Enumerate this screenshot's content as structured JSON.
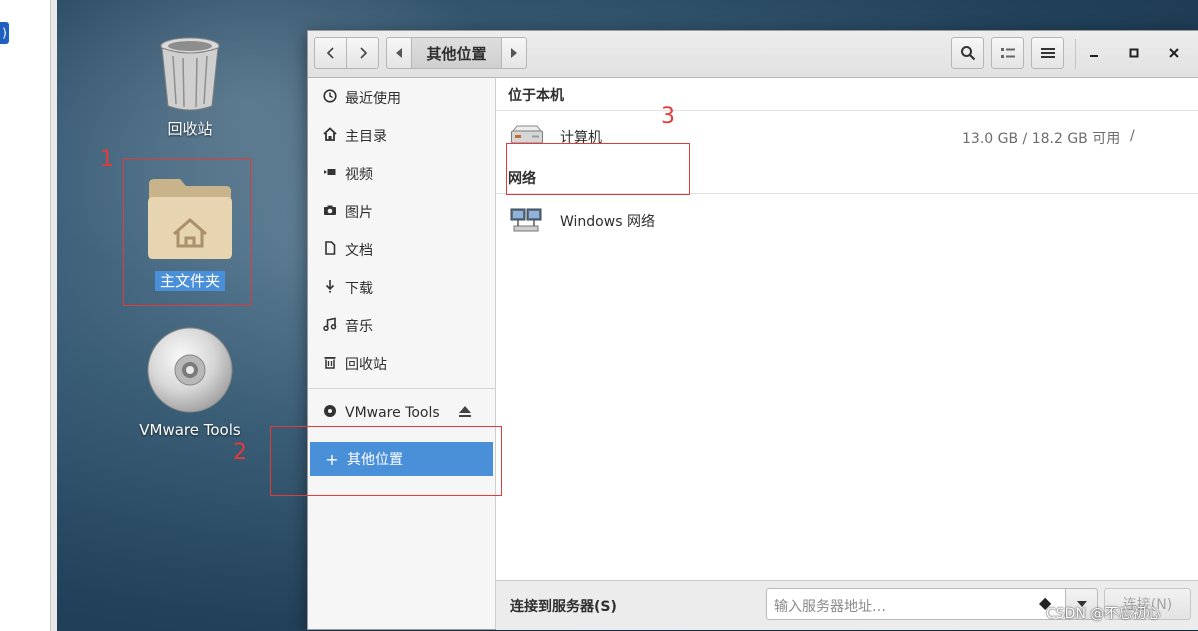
{
  "desktop": {
    "icons": [
      {
        "label": "回收站"
      },
      {
        "label": "主文件夹"
      },
      {
        "label": "VMware Tools"
      }
    ]
  },
  "annotations": [
    "1",
    "2",
    "3"
  ],
  "window": {
    "location_label": "其他位置",
    "sidebar": {
      "items": [
        {
          "label": "最近使用",
          "icon": "clock-icon"
        },
        {
          "label": "主目录",
          "icon": "home-icon"
        },
        {
          "label": "视频",
          "icon": "video-icon"
        },
        {
          "label": "图片",
          "icon": "camera-icon"
        },
        {
          "label": "文档",
          "icon": "document-icon"
        },
        {
          "label": "下载",
          "icon": "download-icon"
        },
        {
          "label": "音乐",
          "icon": "music-icon"
        },
        {
          "label": "回收站",
          "icon": "trash-icon"
        }
      ],
      "device": {
        "label": "VMware Tools",
        "icon": "disc-icon",
        "action_icon": "eject-icon"
      },
      "other": {
        "label": "其他位置",
        "icon": "plus-icon"
      }
    },
    "content": {
      "local_header": "位于本机",
      "computer": {
        "name": "计算机",
        "usage": "13.0 GB / 18.2 GB 可用",
        "path": "/"
      },
      "network_header": "网络",
      "network": {
        "name": "Windows 网络"
      }
    },
    "bottom": {
      "connect_label": "连接到服务器(S)",
      "server_placeholder": "输入服务器地址…",
      "connect_button": "连接(N)"
    }
  },
  "watermark": "CSDN @不忘初心",
  "colors": {
    "selection": "#4a90d9",
    "annotation": "#e23b3b",
    "accent": "#3d7fc4"
  }
}
